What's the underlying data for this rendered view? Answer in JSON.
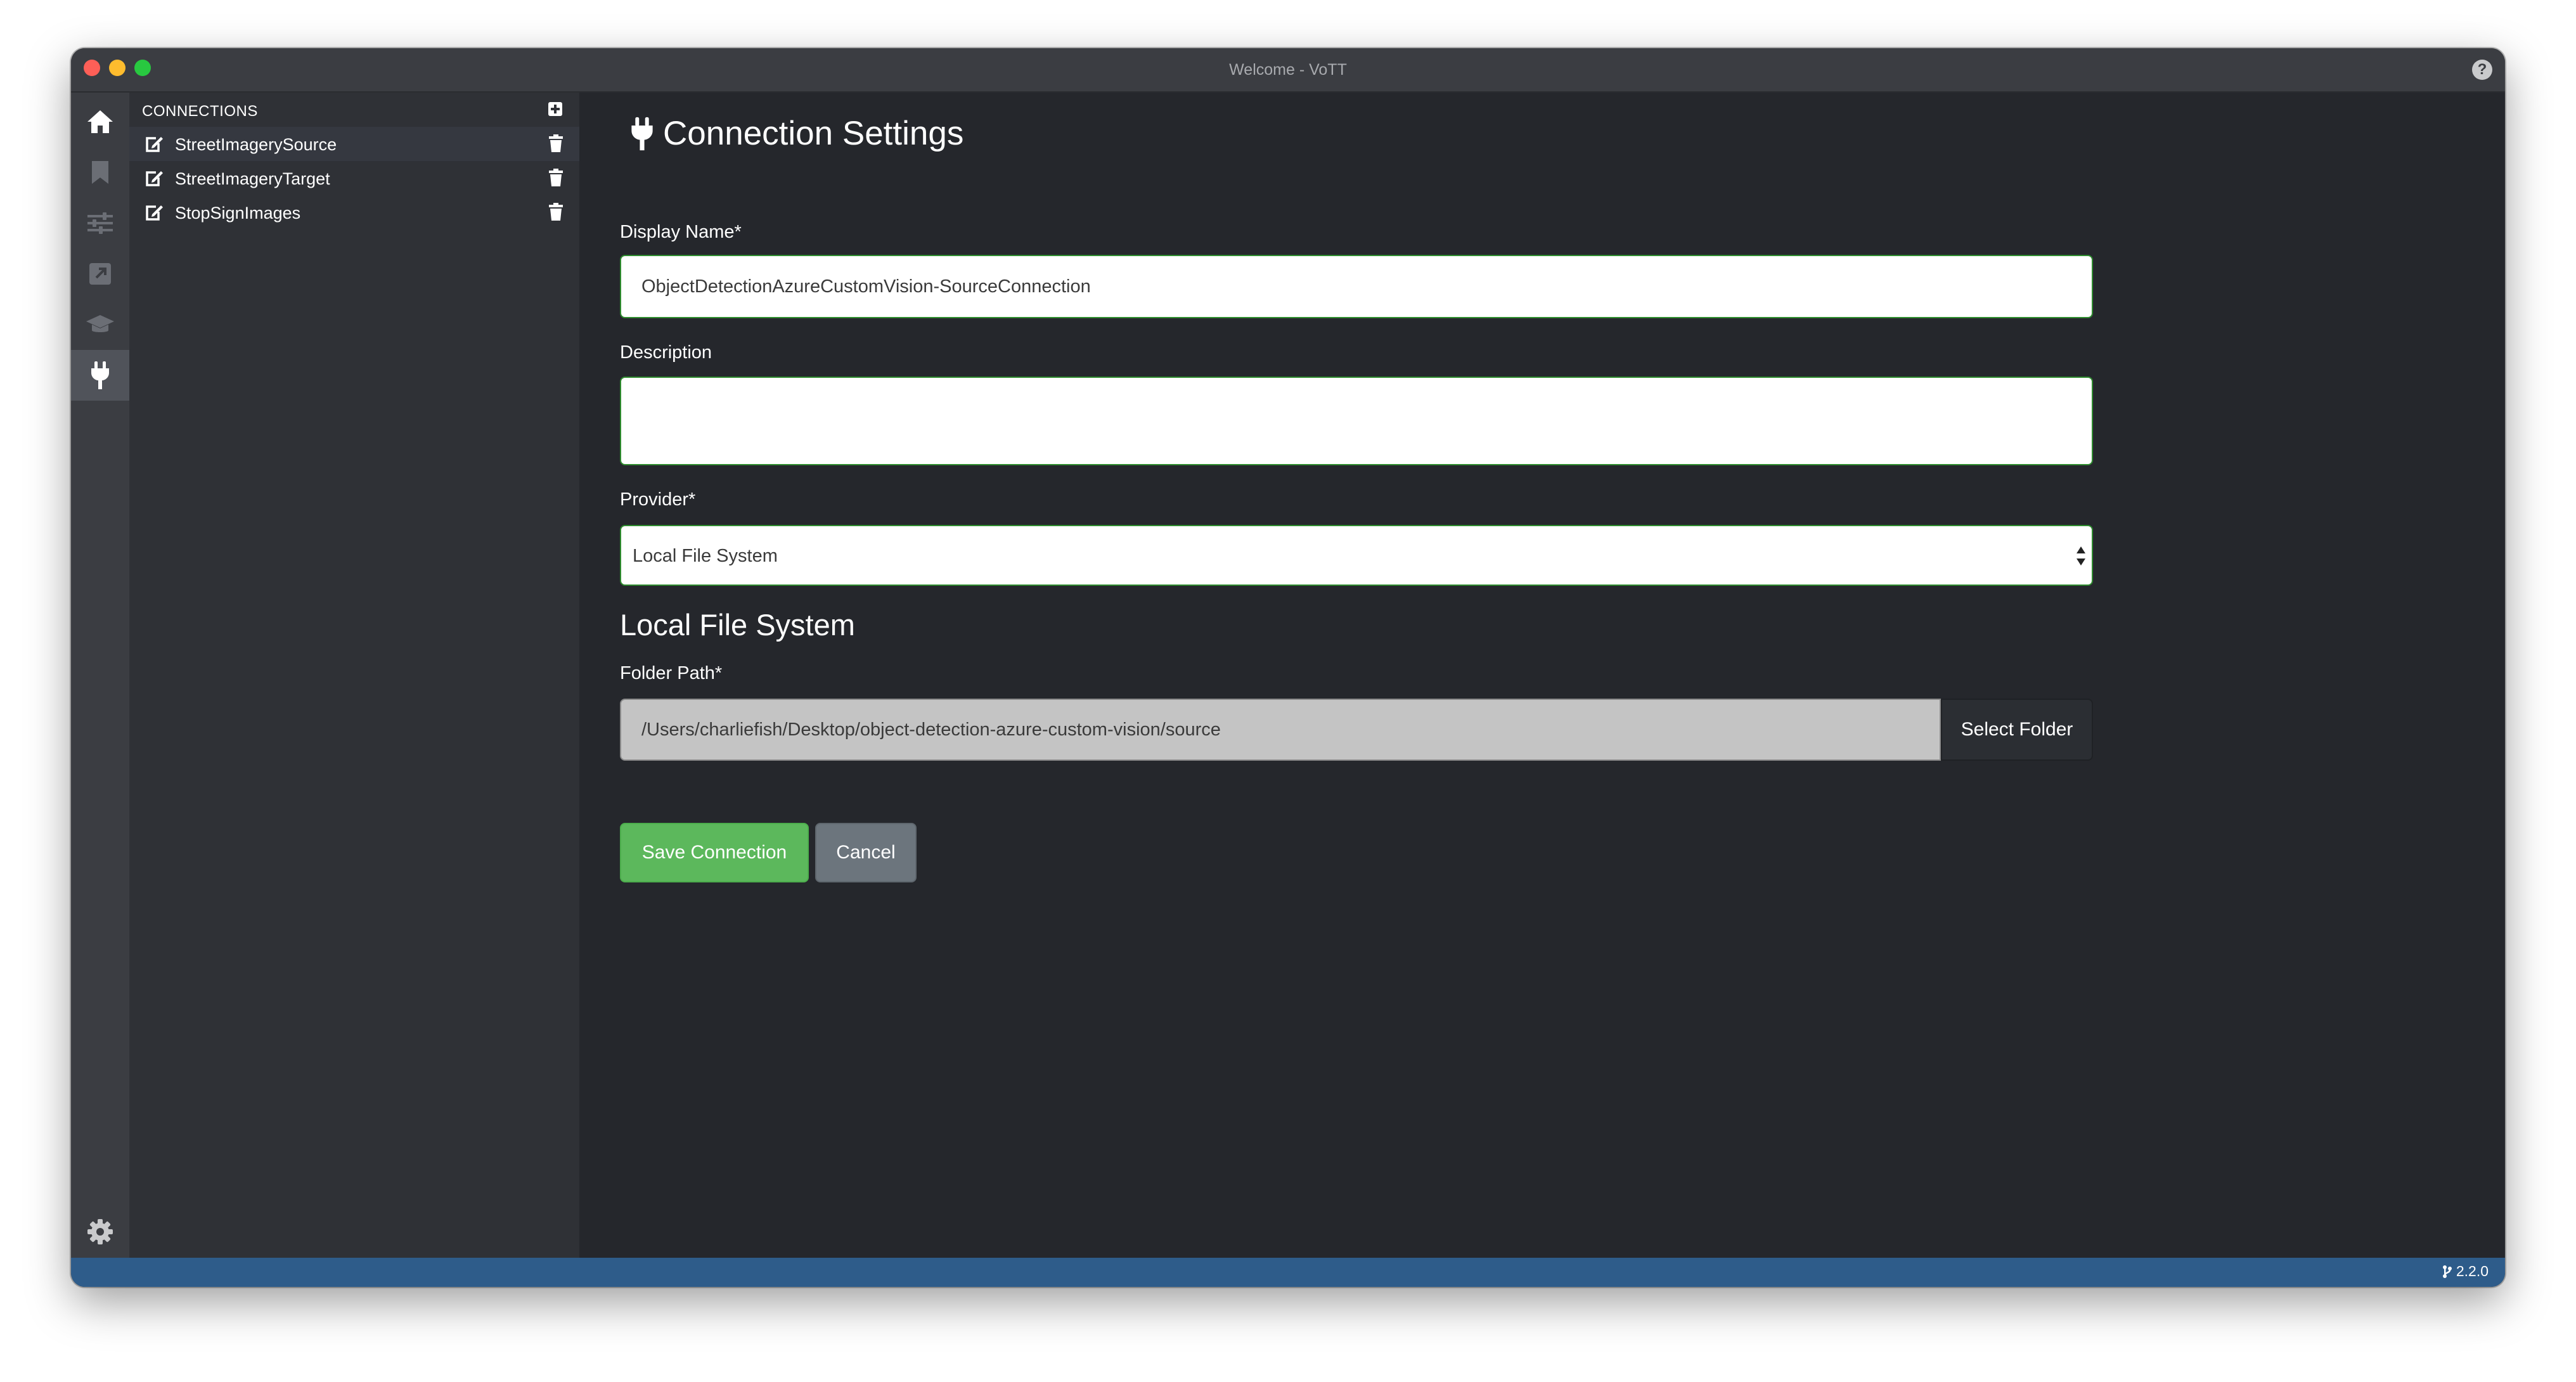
{
  "window": {
    "title": "Welcome - VoTT",
    "help_icon": "question-circle-icon",
    "help_label": "?"
  },
  "iconbar": {
    "items": [
      {
        "name": "home",
        "icon": "home-icon",
        "active": false
      },
      {
        "name": "bookmark",
        "icon": "bookmark-icon",
        "active": false
      },
      {
        "name": "settings",
        "icon": "sliders-icon",
        "active": false
      },
      {
        "name": "export",
        "icon": "external-link-icon",
        "active": false
      },
      {
        "name": "active-learning",
        "icon": "graduation-cap-icon",
        "active": false
      },
      {
        "name": "connections",
        "icon": "plug-icon",
        "active": true
      }
    ],
    "bottom_icon": "gear-icon"
  },
  "sidebar": {
    "header": "CONNECTIONS",
    "add_icon": "plus-square-icon",
    "items": [
      {
        "label": "StreetImagerySource"
      },
      {
        "label": "StreetImageryTarget"
      },
      {
        "label": "StopSignImages"
      }
    ]
  },
  "form": {
    "title": "Connection Settings",
    "display_name_label": "Display Name*",
    "display_name_value": "ObjectDetectionAzureCustomVision-SourceConnection",
    "description_label": "Description",
    "description_value": "",
    "provider_label": "Provider*",
    "provider_value": "Local File System",
    "section_title": "Local File System",
    "folder_path_label": "Folder Path*",
    "folder_path_value": "/Users/charliefish/Desktop/object-detection-azure-custom-vision/source",
    "select_folder_label": "Select Folder",
    "save_label": "Save Connection",
    "cancel_label": "Cancel"
  },
  "statusbar": {
    "version": "2.2.0",
    "version_icon": "code-branch-icon"
  },
  "colors": {
    "accent_green": "#5cb85c",
    "statusbar_blue": "#2e5c8a",
    "background": "#25272c"
  }
}
